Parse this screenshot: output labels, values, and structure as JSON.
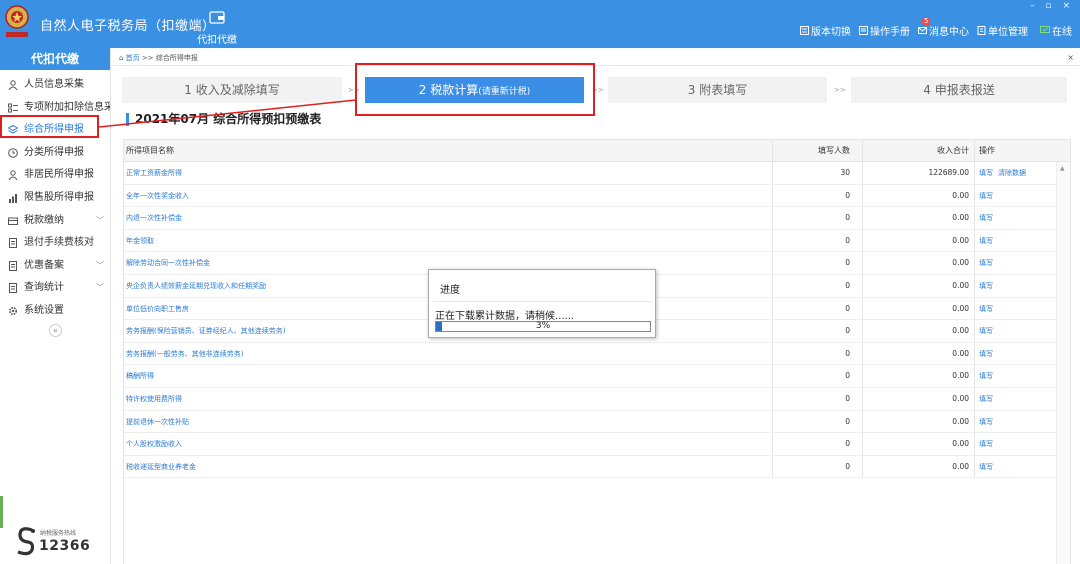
{
  "header": {
    "app_title": "自然人电子税务局（扣缴端）",
    "logo_caption": "税务总局",
    "module_label": "代扣代缴",
    "window_controls": "– ▫ ×",
    "tools": [
      {
        "label": "版本切换",
        "icon": "switch-icon"
      },
      {
        "label": "操作手册",
        "icon": "manual-icon"
      },
      {
        "label": "消息中心",
        "icon": "mail-icon",
        "badge": "5"
      },
      {
        "label": "单位管理",
        "icon": "building-icon"
      },
      {
        "label": "在线",
        "icon": "online-icon"
      }
    ]
  },
  "sidebar": {
    "title": "代扣代缴",
    "items": [
      {
        "label": "人员信息采集",
        "icon": "person-icon"
      },
      {
        "label": "专项附加扣除信息采集",
        "icon": "list-icon"
      },
      {
        "label": "综合所得申报",
        "icon": "layers-icon",
        "active": true
      },
      {
        "label": "分类所得申报",
        "icon": "clock-icon"
      },
      {
        "label": "非居民所得申报",
        "icon": "person-icon"
      },
      {
        "label": "限售股所得申报",
        "icon": "bar-icon"
      },
      {
        "label": "税款缴纳",
        "icon": "payment-icon",
        "expandable": true
      },
      {
        "label": "退付手续费核对",
        "icon": "doc-icon"
      },
      {
        "label": "优惠备案",
        "icon": "doc-icon",
        "expandable": true
      },
      {
        "label": "查询统计",
        "icon": "doc-icon",
        "expandable": true
      },
      {
        "label": "系统设置",
        "icon": "gear-icon"
      }
    ],
    "collapse_glyph": "«",
    "hotline_caption": "纳税服务热线",
    "hotline_number": "12366"
  },
  "breadcrumb": {
    "home": "首页",
    "sep": " >> ",
    "current": "综合所得申报",
    "close": "×"
  },
  "steps": [
    {
      "label": "1 收入及减除填写"
    },
    {
      "label": "2 税款计算",
      "sub": "(请重新计税)",
      "active": true
    },
    {
      "label": "3 附表填写"
    },
    {
      "label": "4 申报表报送"
    }
  ],
  "step_arrow": ">>",
  "page_heading": "2021年07月 综合所得预扣预缴表",
  "table": {
    "headers": [
      "所得项目名称",
      "填写人数",
      "收入合计",
      "操作"
    ],
    "rows": [
      {
        "name": "正常工资薪金所得",
        "count": "30",
        "income": "122689.00",
        "actions": [
          "填写",
          "清除数据"
        ]
      },
      {
        "name": "全年一次性奖金收入",
        "count": "0",
        "income": "0.00",
        "actions": [
          "填写"
        ]
      },
      {
        "name": "内退一次性补偿金",
        "count": "0",
        "income": "0.00",
        "actions": [
          "填写"
        ]
      },
      {
        "name": "年金领取",
        "count": "0",
        "income": "0.00",
        "actions": [
          "填写"
        ]
      },
      {
        "name": "解除劳动合同一次性补偿金",
        "count": "0",
        "income": "0.00",
        "actions": [
          "填写"
        ]
      },
      {
        "name": "央企负责人绩效薪金延期兑现收入和任期奖励",
        "count": "0",
        "income": "0.00",
        "actions": [
          "填写"
        ]
      },
      {
        "name": "单位低价向职工售房",
        "count": "0",
        "income": "0.00",
        "actions": [
          "填写"
        ]
      },
      {
        "name": "劳务报酬(保险营销员、证券经纪人、其他连续劳务)",
        "count": "0",
        "income": "0.00",
        "actions": [
          "填写"
        ]
      },
      {
        "name": "劳务报酬(一般劳务、其他非连续劳务)",
        "count": "0",
        "income": "0.00",
        "actions": [
          "填写"
        ]
      },
      {
        "name": "稿酬所得",
        "count": "0",
        "income": "0.00",
        "actions": [
          "填写"
        ]
      },
      {
        "name": "特许权使用费所得",
        "count": "0",
        "income": "0.00",
        "actions": [
          "填写"
        ]
      },
      {
        "name": "提前退休一次性补贴",
        "count": "0",
        "income": "0.00",
        "actions": [
          "填写"
        ]
      },
      {
        "name": "个人股权激励收入",
        "count": "0",
        "income": "0.00",
        "actions": [
          "填写"
        ]
      },
      {
        "name": "税收递延型商业养老金",
        "count": "0",
        "income": "0.00",
        "actions": [
          "填写"
        ]
      }
    ]
  },
  "dialog": {
    "title": "进度",
    "message": "正在下载累计数据，请稍候......",
    "progress": 0.03,
    "progress_text": "3%"
  },
  "colors": {
    "header": "#3a90e3",
    "active_step": "#3a8ee6",
    "link": "#2a7ad5",
    "annotation": "#e02020"
  }
}
